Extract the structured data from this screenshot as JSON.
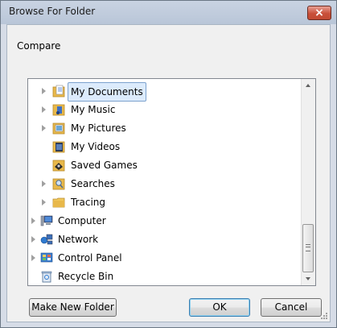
{
  "window": {
    "title": "Browse For Folder",
    "close_glyph": "×"
  },
  "description": "Compare",
  "tree": {
    "items": [
      {
        "label": "My Documents",
        "icon": "documents-folder-icon",
        "expandable": true,
        "selected": true
      },
      {
        "label": "My Music",
        "icon": "music-folder-icon",
        "expandable": true,
        "selected": false
      },
      {
        "label": "My Pictures",
        "icon": "pictures-folder-icon",
        "expandable": true,
        "selected": false
      },
      {
        "label": "My Videos",
        "icon": "videos-folder-icon",
        "expandable": false,
        "selected": false
      },
      {
        "label": "Saved Games",
        "icon": "saved-games-icon",
        "expandable": false,
        "selected": false
      },
      {
        "label": "Searches",
        "icon": "searches-folder-icon",
        "expandable": true,
        "selected": false
      },
      {
        "label": "Tracing",
        "icon": "folder-icon",
        "expandable": true,
        "selected": false
      },
      {
        "label": "Computer",
        "icon": "computer-icon",
        "expandable": true,
        "selected": false
      },
      {
        "label": "Network",
        "icon": "network-icon",
        "expandable": true,
        "selected": false
      },
      {
        "label": "Control Panel",
        "icon": "control-panel-icon",
        "expandable": true,
        "selected": false
      },
      {
        "label": "Recycle Bin",
        "icon": "recycle-bin-icon",
        "expandable": false,
        "selected": false
      }
    ]
  },
  "buttons": {
    "make_new_folder": "Make New Folder",
    "ok": "OK",
    "cancel": "Cancel"
  },
  "colors": {
    "title_bar": "#c9d3e2",
    "close_button": "#c9503a",
    "selection": "#dcebfc",
    "folder": "#e8b84a"
  }
}
